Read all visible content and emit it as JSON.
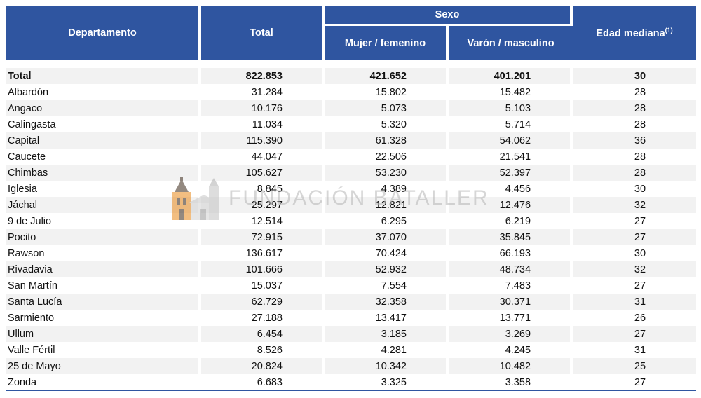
{
  "table": {
    "headers": {
      "departamento": "Departamento",
      "total": "Total",
      "sexo": "Sexo",
      "mujer": "Mujer / femenino",
      "varon": "Varón / masculino",
      "edad": "Edad mediana",
      "edad_note": "(1)"
    },
    "total_row": {
      "name": "Total",
      "total": "822.853",
      "mujer": "421.652",
      "varon": "401.201",
      "edad": "30"
    },
    "rows": [
      {
        "name": "Albardón",
        "total": "31.284",
        "mujer": "15.802",
        "varon": "15.482",
        "edad": "28"
      },
      {
        "name": "Angaco",
        "total": "10.176",
        "mujer": "5.073",
        "varon": "5.103",
        "edad": "28"
      },
      {
        "name": "Calingasta",
        "total": "11.034",
        "mujer": "5.320",
        "varon": "5.714",
        "edad": "28"
      },
      {
        "name": "Capital",
        "total": "115.390",
        "mujer": "61.328",
        "varon": "54.062",
        "edad": "36"
      },
      {
        "name": "Caucete",
        "total": "44.047",
        "mujer": "22.506",
        "varon": "21.541",
        "edad": "28"
      },
      {
        "name": "Chimbas",
        "total": "105.627",
        "mujer": "53.230",
        "varon": "52.397",
        "edad": "28"
      },
      {
        "name": "Iglesia",
        "total": "8.845",
        "mujer": "4.389",
        "varon": "4.456",
        "edad": "30"
      },
      {
        "name": "Jáchal",
        "total": "25.297",
        "mujer": "12.821",
        "varon": "12.476",
        "edad": "32"
      },
      {
        "name": "9 de Julio",
        "total": "12.514",
        "mujer": "6.295",
        "varon": "6.219",
        "edad": "27"
      },
      {
        "name": "Pocito",
        "total": "72.915",
        "mujer": "37.070",
        "varon": "35.845",
        "edad": "27"
      },
      {
        "name": "Rawson",
        "total": "136.617",
        "mujer": "70.424",
        "varon": "66.193",
        "edad": "30"
      },
      {
        "name": "Rivadavia",
        "total": "101.666",
        "mujer": "52.932",
        "varon": "48.734",
        "edad": "32"
      },
      {
        "name": "San Martín",
        "total": "15.037",
        "mujer": "7.554",
        "varon": "7.483",
        "edad": "27"
      },
      {
        "name": "Santa Lucía",
        "total": "62.729",
        "mujer": "32.358",
        "varon": "30.371",
        "edad": "31"
      },
      {
        "name": "Sarmiento",
        "total": "27.188",
        "mujer": "13.417",
        "varon": "13.771",
        "edad": "26"
      },
      {
        "name": "Ullum",
        "total": "6.454",
        "mujer": "3.185",
        "varon": "3.269",
        "edad": "27"
      },
      {
        "name": "Valle Fértil",
        "total": "8.526",
        "mujer": "4.281",
        "varon": "4.245",
        "edad": "31"
      },
      {
        "name": "25 de Mayo",
        "total": "20.824",
        "mujer": "10.342",
        "varon": "10.482",
        "edad": "25"
      },
      {
        "name": "Zonda",
        "total": "6.683",
        "mujer": "3.325",
        "varon": "3.358",
        "edad": "27"
      }
    ]
  },
  "watermark": {
    "text": "FUNDACIÓN BATALLER",
    "colors": {
      "orange": "#e8891c",
      "dark": "#3b2a1a",
      "gray": "#b5b5b5"
    }
  },
  "colors": {
    "header_bg": "#2f55a0",
    "stripe": "#f2f2f2"
  }
}
